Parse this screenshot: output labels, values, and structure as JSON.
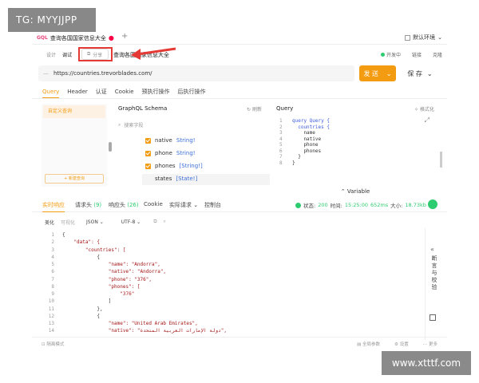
{
  "watermark_top_left": "TG: MYYJJPP",
  "watermark_bottom_right": "www.xtttf.com",
  "tab": {
    "badge": "GQL",
    "title": "查询各国国家信息大全",
    "dot": "●",
    "close": "×",
    "add": "+"
  },
  "environment": {
    "label": "默认环境",
    "chevron": "⌄"
  },
  "modes": {
    "design": "设计",
    "debug": "调试"
  },
  "share": {
    "label": "分享"
  },
  "api_name": "查询各国国家信息大全",
  "mode_right": {
    "env": "开发中",
    "share": "链接",
    "more": "克隆"
  },
  "url": {
    "method": "—",
    "value": "https://countries.trevorblades.com/"
  },
  "send": {
    "label": "发 送",
    "chevron": "⌄"
  },
  "save": {
    "label": "保 存",
    "chevron": "⌄"
  },
  "request_tabs": [
    "Query",
    "Header",
    "认证",
    "Cookie",
    "预执行操作",
    "后执行操作"
  ],
  "left_panel": {
    "custom_query": "自定义查询",
    "new_query": "+ 新建查询"
  },
  "schema": {
    "title": "GraphQL Schema",
    "refresh": "刷新",
    "search_placeholder": "搜索字段",
    "fields": [
      {
        "name": "native",
        "type": "String!",
        "checked": true
      },
      {
        "name": "phone",
        "type": "String!",
        "checked": true
      },
      {
        "name": "phones",
        "type": "[String!]",
        "checked": true
      },
      {
        "name": "states",
        "type": "[State!]",
        "checked": false
      }
    ]
  },
  "query_editor": {
    "title": "Query",
    "format": "格式化",
    "lines": [
      {
        "n": "1",
        "text": "query Query {"
      },
      {
        "n": "2",
        "text": "  countries {"
      },
      {
        "n": "3",
        "text": "    name"
      },
      {
        "n": "4",
        "text": "    native"
      },
      {
        "n": "5",
        "text": "    phone"
      },
      {
        "n": "6",
        "text": "    phones"
      },
      {
        "n": "7",
        "text": "  }"
      },
      {
        "n": "8",
        "text": "}"
      }
    ]
  },
  "variable_label": "Variable",
  "response_tabs": {
    "realtime": "实时响应",
    "req_headers": "请求头",
    "req_headers_count": "(9)",
    "resp_headers": "响应头",
    "resp_headers_count": "(26)",
    "cookie": "Cookie",
    "actual_request": "实际请求",
    "console": "控制台"
  },
  "status": {
    "label": "状态:",
    "code": "200",
    "time_label": "时间:",
    "time": "15:25:00",
    "duration": "652ms",
    "size_label": "大小:",
    "size": "18.73kb"
  },
  "resp_toolbar": {
    "beautify": "美化",
    "visualize": "可视化",
    "format": "JSON",
    "encoding": "UTF-8"
  },
  "response_lines": [
    {
      "n": "1",
      "text": "{"
    },
    {
      "n": "2",
      "text": "    \"data\": {"
    },
    {
      "n": "3",
      "text": "        \"countries\": ["
    },
    {
      "n": "4",
      "text": "            {"
    },
    {
      "n": "5",
      "text": "                \"name\": \"Andorra\","
    },
    {
      "n": "6",
      "text": "                \"native\": \"Andorra\","
    },
    {
      "n": "7",
      "text": "                \"phone\": \"376\","
    },
    {
      "n": "8",
      "text": "                \"phones\": ["
    },
    {
      "n": "9",
      "text": "                    \"376\""
    },
    {
      "n": "10",
      "text": "                ]"
    },
    {
      "n": "11",
      "text": "            },"
    },
    {
      "n": "12",
      "text": "            {"
    },
    {
      "n": "13",
      "text": "                \"name\": \"United Arab Emirates\","
    },
    {
      "n": "14",
      "text": "                \"native\": \"دولة الإمارات العربية المتحدة\","
    }
  ],
  "side_panel": {
    "label": "断言与校验",
    "chevron": "«"
  },
  "footer": {
    "left": "隔离模式",
    "global_params": "全局参数",
    "settings": "设置",
    "more": "更多"
  }
}
